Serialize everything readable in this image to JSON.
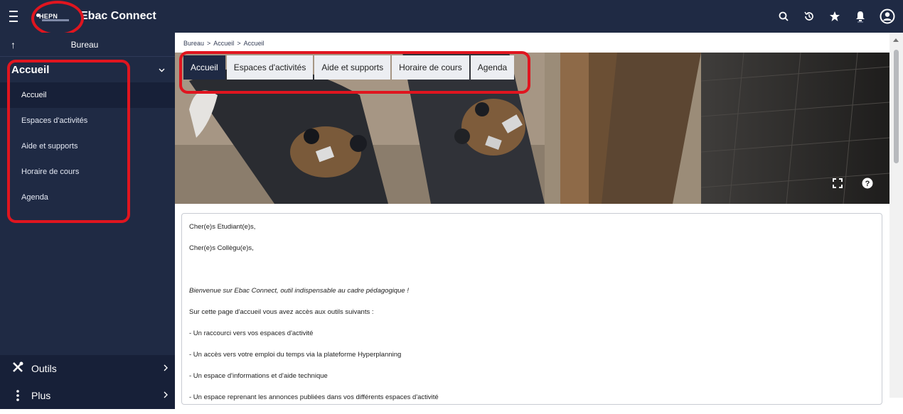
{
  "header": {
    "logo_text": "HEPN",
    "app_title": "Ebac Connect",
    "icons": [
      "search-icon",
      "history-icon",
      "star-icon",
      "bell-icon",
      "user-icon"
    ]
  },
  "sidebar": {
    "back_label": "Bureau",
    "section_title": "Accueil",
    "items": [
      {
        "label": "Accueil",
        "active": true
      },
      {
        "label": "Espaces d'activités"
      },
      {
        "label": "Aide et supports"
      },
      {
        "label": "Horaire de cours"
      },
      {
        "label": "Agenda"
      }
    ],
    "bottom": [
      {
        "label": "Outils",
        "icon": "tools-icon"
      },
      {
        "label": "Plus",
        "icon": "more-vertical-icon"
      }
    ]
  },
  "breadcrumb": [
    "Bureau",
    ">",
    "Accueil",
    ">",
    "Accueil"
  ],
  "tabs": [
    {
      "label": "Accueil",
      "active": true
    },
    {
      "label": "Espaces d'activités"
    },
    {
      "label": "Aide et supports"
    },
    {
      "label": "Horaire de cours"
    },
    {
      "label": "Agenda"
    }
  ],
  "content": {
    "lines": [
      "Cher(e)s Etudiant(e)s,",
      "Cher(e)s Collègu(e)s,",
      "",
      "Bienvenue sur Ebac Connect, outil indispensable au cadre pédagogique !",
      "Sur cette page d'accueil vous avez accès aux outils suivants :",
      "- Un raccourci vers vos espaces d'activité",
      "- Un accès vers votre emploi du temps via la plateforme Hyperplanning",
      "- Un espace d'informations et d'aide technique",
      "- Un espace reprenant les annonces publiées dans vos différents espaces d'activité"
    ]
  },
  "colors": {
    "nav_bg": "#1f2a44",
    "highlight": "#e0151f"
  }
}
